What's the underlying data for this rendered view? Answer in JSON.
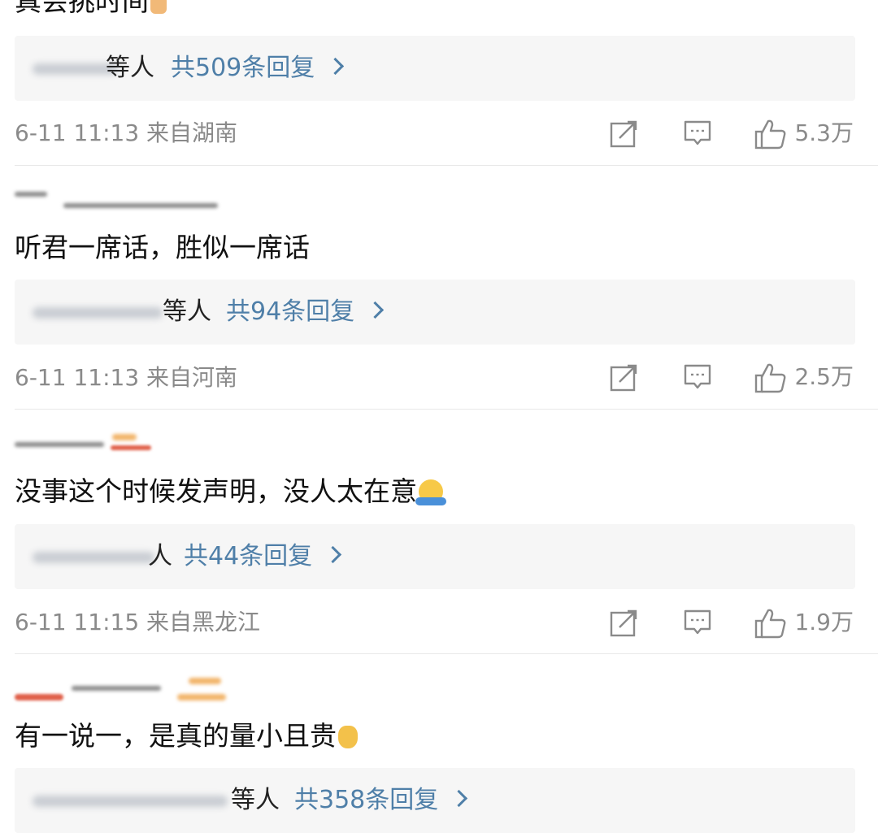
{
  "comments": [
    {
      "text": "真会挑时间",
      "reply_suffix": "等人",
      "reply_count": "共509条回复",
      "time": "6-11 11:13",
      "location": "来自湖南",
      "likes": "5.3万"
    },
    {
      "text": "听君一席话，胜似一席话",
      "reply_suffix": "等人",
      "reply_count": "共94条回复",
      "time": "6-11 11:13",
      "location": "来自河南",
      "likes": "2.5万"
    },
    {
      "text": "没事这个时候发声明，没人太在意",
      "reply_suffix": "人",
      "reply_count": "共44条回复",
      "time": "6-11 11:15",
      "location": "来自黑龙江",
      "likes": "1.9万"
    },
    {
      "text": "有一说一，是真的量小且贵",
      "reply_suffix": "等人",
      "reply_count": "共358条回复"
    }
  ],
  "icons": {
    "share": "share-icon",
    "comment": "comment-icon",
    "like": "thumbs-up-icon"
  },
  "colors": {
    "link": "#4f7fa8",
    "meta": "#8a8a8a",
    "reply_bg": "#f6f6f6"
  }
}
